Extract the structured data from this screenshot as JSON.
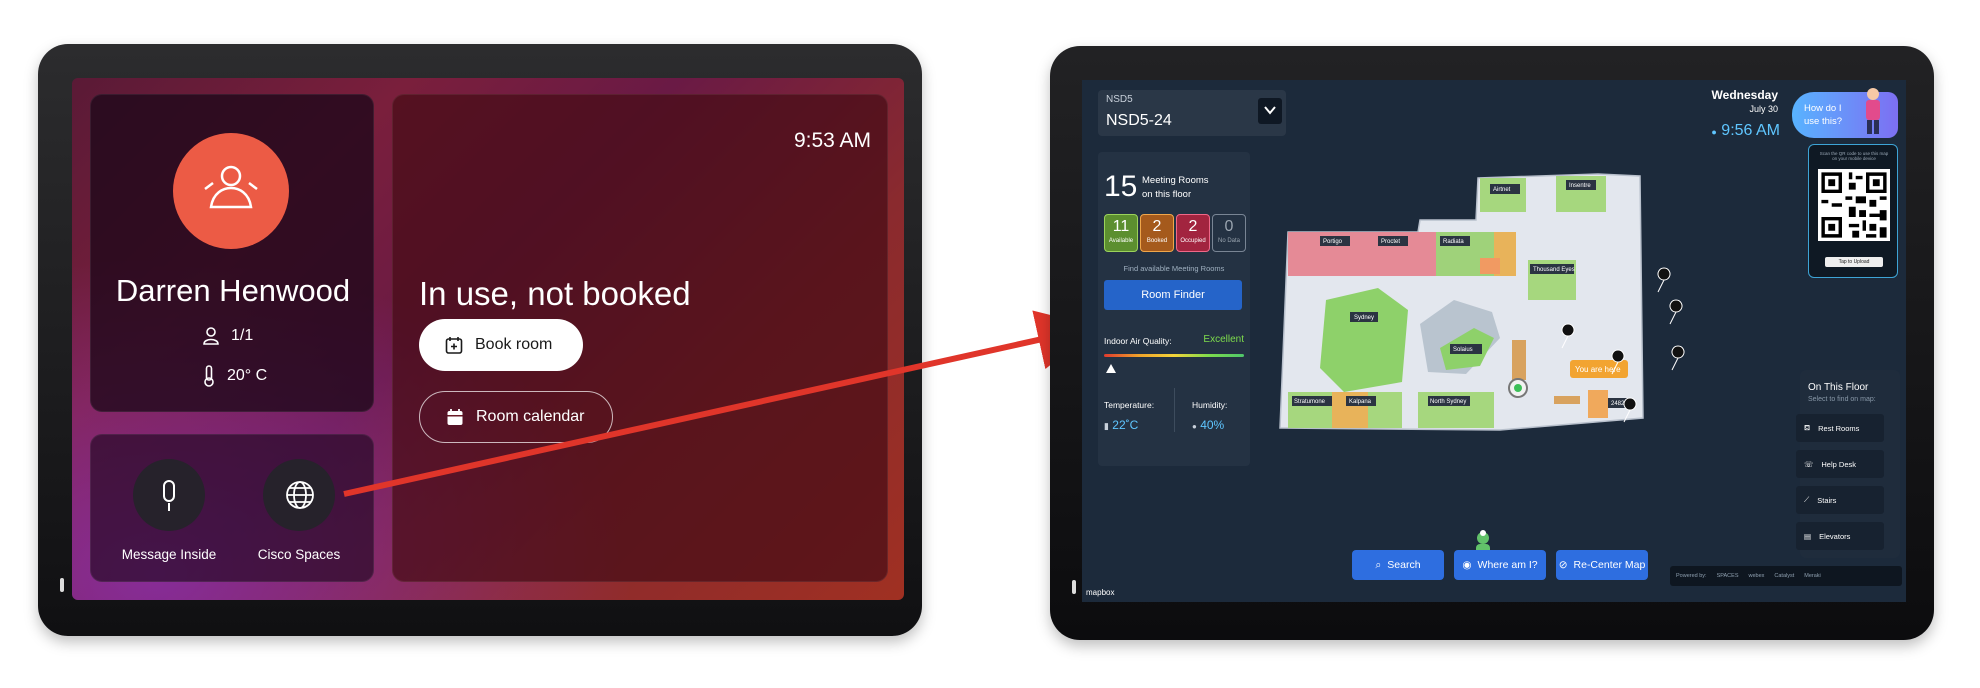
{
  "left_device": {
    "user": {
      "name": "Darren Henwood",
      "capacity": "1/1",
      "temperature": "20° C"
    },
    "actions": {
      "message_label": "Message Inside",
      "spaces_label": "Cisco Spaces"
    },
    "clock": "9:53 AM",
    "status": "In use, not booked",
    "book_label": "Book room",
    "calendar_label": "Room calendar"
  },
  "right_device": {
    "floor": {
      "building": "NSD5",
      "name": "NSD5-24"
    },
    "date": {
      "day": "Wednesday",
      "month_day": "July 30"
    },
    "time": "9:56 AM",
    "help": "How do I use this?",
    "qr": {
      "caption": "Scan the QR code to use this map on your mobile device",
      "button": "Tap to Upload"
    },
    "rooms": {
      "count": "15",
      "label_line1": "Meeting Rooms",
      "label_line2": "on this floor",
      "stats": [
        {
          "n": "11",
          "label": "Available"
        },
        {
          "n": "2",
          "label": "Booked"
        },
        {
          "n": "2",
          "label": "Occupied"
        },
        {
          "n": "0",
          "label": "No Data"
        }
      ],
      "find_label": "Find available Meeting Rooms",
      "finder_button": "Room Finder"
    },
    "environment": {
      "iaq_label": "Indoor Air Quality:",
      "iaq_value": "Excellent",
      "iaq_level": 0.05,
      "temp_label": "Temperature:",
      "temp_value": "22˚C",
      "humidity_label": "Humidity:",
      "humidity_value": "40%"
    },
    "map_labels": [
      "Airtnet",
      "Insentre",
      "Portigo",
      "Proctet",
      "Radiata",
      "Thousand Eyes",
      "Sydney",
      "Solaius",
      "Stratumone",
      "Kalpana",
      "North Sydney",
      "2482"
    ],
    "you_are_here": "You are here",
    "on_this_floor": {
      "title": "On This Floor",
      "subtitle": "Select to find on map:",
      "items": [
        "Rest Rooms",
        "Help Desk",
        "Stairs",
        "Elevators"
      ]
    },
    "bottom_buttons": {
      "search": "Search",
      "where": "Where am I?",
      "recenter": "Re-Center Map"
    },
    "powered_by": {
      "label": "Powered by:",
      "brands": [
        "SPACES",
        "webex",
        "Catalyst",
        "Meraki"
      ]
    },
    "brand": "mapbox"
  },
  "colors": {
    "accent_orange": "#ec5b45",
    "map_blue": "#2e6ee0",
    "available_green": "#5c8f2f",
    "booked_orange": "#a55a1c",
    "occupied_red": "#a2243f",
    "arrow_red": "#e0352a"
  }
}
